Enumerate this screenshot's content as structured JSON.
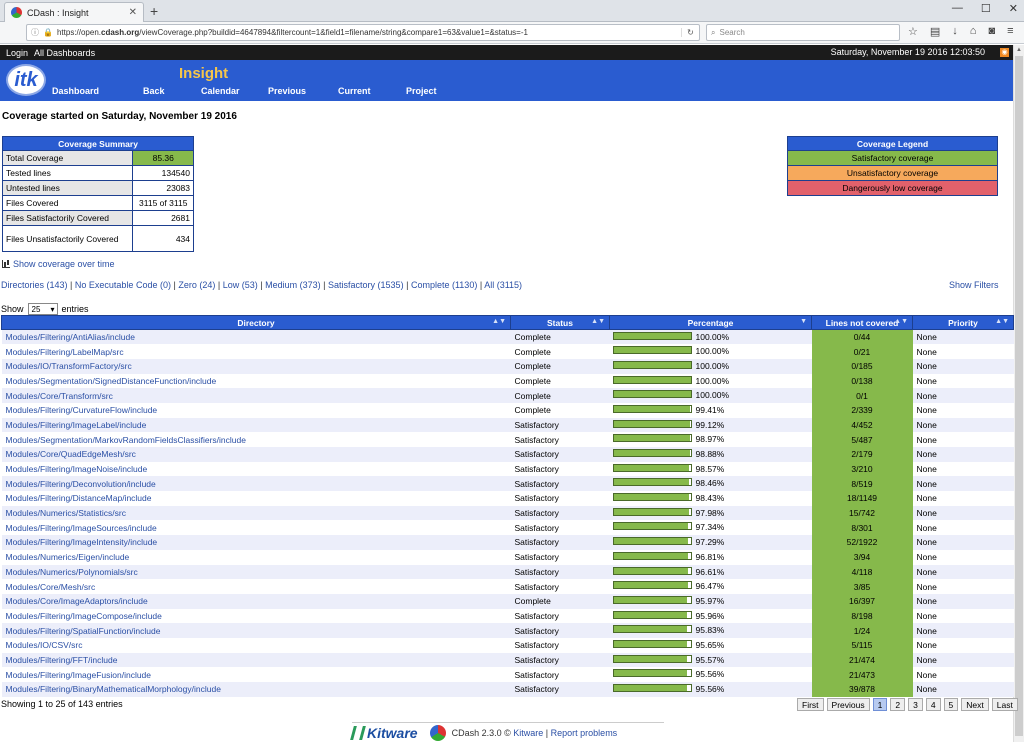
{
  "browser": {
    "tab_title": "CDash : Insight",
    "url_prefix": "https://open.",
    "url_host": "cdash.org",
    "url_rest": "/viewCoverage.php?buildid=4647894&filtercount=1&field1=filename/string&compare1=63&value1=&status=-1",
    "search_placeholder": "Search"
  },
  "header": {
    "login": "Login",
    "all_dashboards": "All Dashboards",
    "date": "Saturday, November 19 2016 12:03:50",
    "project": "Insight",
    "logo_text": "itk",
    "menu": [
      "Dashboard",
      "Back",
      "Calendar",
      "Previous",
      "Current",
      "Project"
    ]
  },
  "page_title": "Coverage started on Saturday, November 19 2016",
  "summary": {
    "title": "Coverage Summary",
    "rows": [
      {
        "label": "Total Coverage",
        "value": "85.36"
      },
      {
        "label": "Tested lines",
        "value": "134540"
      },
      {
        "label": "Untested lines",
        "value": "23083"
      },
      {
        "label": "Files Covered",
        "value": "3115 of 3115"
      },
      {
        "label": "Files Satisfactorily Covered",
        "value": "2681"
      },
      {
        "label": "Files Unsatisfactorily Covered",
        "value": "434"
      }
    ]
  },
  "legend": {
    "title": "Coverage Legend",
    "items": [
      "Satisfactory coverage",
      "Unsatisfactory coverage",
      "Dangerously low coverage"
    ],
    "colors": [
      "#86b94b",
      "#f6a95c",
      "#e2616b"
    ]
  },
  "show_over_time": "Show coverage over time",
  "filters": [
    "Directories (143)",
    "No Executable Code (0)",
    "Zero (24)",
    "Low (53)",
    "Medium (373)",
    "Satisfactory (1535)",
    "Complete (1130)",
    "All (3115)"
  ],
  "show_filters": "Show Filters",
  "entries": {
    "show": "Show",
    "value": "25",
    "suffix": "entries"
  },
  "table": {
    "headers": [
      "Directory",
      "Status",
      "Percentage",
      "Lines not covered",
      "Priority"
    ],
    "rows": [
      {
        "dir": "Modules/Filtering/AntiAlias/include",
        "status": "Complete",
        "pct": "100.00%",
        "pct_value": 100.0,
        "lines": "0/44",
        "priority": "None"
      },
      {
        "dir": "Modules/Filtering/LabelMap/src",
        "status": "Complete",
        "pct": "100.00%",
        "pct_value": 100.0,
        "lines": "0/21",
        "priority": "None"
      },
      {
        "dir": "Modules/IO/TransformFactory/src",
        "status": "Complete",
        "pct": "100.00%",
        "pct_value": 100.0,
        "lines": "0/185",
        "priority": "None"
      },
      {
        "dir": "Modules/Segmentation/SignedDistanceFunction/include",
        "status": "Complete",
        "pct": "100.00%",
        "pct_value": 100.0,
        "lines": "0/138",
        "priority": "None"
      },
      {
        "dir": "Modules/Core/Transform/src",
        "status": "Complete",
        "pct": "100.00%",
        "pct_value": 100.0,
        "lines": "0/1",
        "priority": "None"
      },
      {
        "dir": "Modules/Filtering/CurvatureFlow/include",
        "status": "Complete",
        "pct": "99.41%",
        "pct_value": 99.41,
        "lines": "2/339",
        "priority": "None"
      },
      {
        "dir": "Modules/Filtering/ImageLabel/include",
        "status": "Satisfactory",
        "pct": "99.12%",
        "pct_value": 99.12,
        "lines": "4/452",
        "priority": "None"
      },
      {
        "dir": "Modules/Segmentation/MarkovRandomFieldsClassifiers/include",
        "status": "Satisfactory",
        "pct": "98.97%",
        "pct_value": 98.97,
        "lines": "5/487",
        "priority": "None"
      },
      {
        "dir": "Modules/Core/QuadEdgeMesh/src",
        "status": "Satisfactory",
        "pct": "98.88%",
        "pct_value": 98.88,
        "lines": "2/179",
        "priority": "None"
      },
      {
        "dir": "Modules/Filtering/ImageNoise/include",
        "status": "Satisfactory",
        "pct": "98.57%",
        "pct_value": 98.57,
        "lines": "3/210",
        "priority": "None"
      },
      {
        "dir": "Modules/Filtering/Deconvolution/include",
        "status": "Satisfactory",
        "pct": "98.46%",
        "pct_value": 98.46,
        "lines": "8/519",
        "priority": "None"
      },
      {
        "dir": "Modules/Filtering/DistanceMap/include",
        "status": "Satisfactory",
        "pct": "98.43%",
        "pct_value": 98.43,
        "lines": "18/1149",
        "priority": "None"
      },
      {
        "dir": "Modules/Numerics/Statistics/src",
        "status": "Satisfactory",
        "pct": "97.98%",
        "pct_value": 97.98,
        "lines": "15/742",
        "priority": "None"
      },
      {
        "dir": "Modules/Filtering/ImageSources/include",
        "status": "Satisfactory",
        "pct": "97.34%",
        "pct_value": 97.34,
        "lines": "8/301",
        "priority": "None"
      },
      {
        "dir": "Modules/Filtering/ImageIntensity/include",
        "status": "Satisfactory",
        "pct": "97.29%",
        "pct_value": 97.29,
        "lines": "52/1922",
        "priority": "None"
      },
      {
        "dir": "Modules/Numerics/Eigen/include",
        "status": "Satisfactory",
        "pct": "96.81%",
        "pct_value": 96.81,
        "lines": "3/94",
        "priority": "None"
      },
      {
        "dir": "Modules/Numerics/Polynomials/src",
        "status": "Satisfactory",
        "pct": "96.61%",
        "pct_value": 96.61,
        "lines": "4/118",
        "priority": "None"
      },
      {
        "dir": "Modules/Core/Mesh/src",
        "status": "Satisfactory",
        "pct": "96.47%",
        "pct_value": 96.47,
        "lines": "3/85",
        "priority": "None"
      },
      {
        "dir": "Modules/Core/ImageAdaptors/include",
        "status": "Complete",
        "pct": "95.97%",
        "pct_value": 95.97,
        "lines": "16/397",
        "priority": "None"
      },
      {
        "dir": "Modules/Filtering/ImageCompose/include",
        "status": "Satisfactory",
        "pct": "95.96%",
        "pct_value": 95.96,
        "lines": "8/198",
        "priority": "None"
      },
      {
        "dir": "Modules/Filtering/SpatialFunction/include",
        "status": "Satisfactory",
        "pct": "95.83%",
        "pct_value": 95.83,
        "lines": "1/24",
        "priority": "None"
      },
      {
        "dir": "Modules/IO/CSV/src",
        "status": "Satisfactory",
        "pct": "95.65%",
        "pct_value": 95.65,
        "lines": "5/115",
        "priority": "None"
      },
      {
        "dir": "Modules/Filtering/FFT/include",
        "status": "Satisfactory",
        "pct": "95.57%",
        "pct_value": 95.57,
        "lines": "21/474",
        "priority": "None"
      },
      {
        "dir": "Modules/Filtering/ImageFusion/include",
        "status": "Satisfactory",
        "pct": "95.56%",
        "pct_value": 95.56,
        "lines": "21/473",
        "priority": "None"
      },
      {
        "dir": "Modules/Filtering/BinaryMathematicalMorphology/include",
        "status": "Satisfactory",
        "pct": "95.56%",
        "pct_value": 95.56,
        "lines": "39/878",
        "priority": "None"
      }
    ]
  },
  "showing": "Showing 1 to 25 of 143 entries",
  "pager": {
    "first": "First",
    "previous": "Previous",
    "pages": [
      "1",
      "2",
      "3",
      "4",
      "5"
    ],
    "next": "Next",
    "last": "Last",
    "active": "1"
  },
  "footer": {
    "brand": "Kitware",
    "version": "CDash 2.3.0 ©",
    "kitware_link": "Kitware",
    "sep": "|",
    "report": "Report problems"
  }
}
